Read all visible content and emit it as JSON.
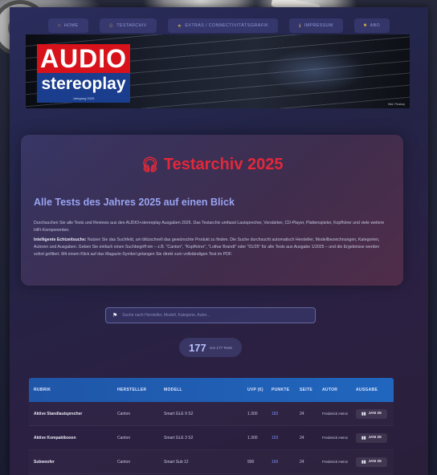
{
  "nav": [
    {
      "icon": "home-icon",
      "glyph": "⌂",
      "label": "HOME"
    },
    {
      "icon": "headphones-icon",
      "glyph": "☉",
      "label": "TESTARCHIV"
    },
    {
      "icon": "star-icon",
      "glyph": "★",
      "label": "EXTRAS / CONNECTIVITÄTSGRAFIK"
    },
    {
      "icon": "info-icon",
      "glyph": "ℹ",
      "label": "IMPRESSUM"
    },
    {
      "icon": "book-icon",
      "glyph": "■",
      "label": "ABO"
    }
  ],
  "banner": {
    "logo_audio": "AUDIO",
    "logo_stereoplay": "stereoplay",
    "logo_year": "Jahrgang 2025",
    "credit": "Bild: Pixabay"
  },
  "hero": {
    "title": "Testarchiv 2025",
    "title_icon": "headphones-icon",
    "subtitle": "Alle Tests des Jahres 2025 auf einen Blick",
    "paragraph1": "Durchsuchen Sie alle Tests und Reviews aus den AUDIO+stereoplay Ausgaben 2025. Das Testarchiv umfasst Lautsprecher, Verstärker, CD-Player, Plattenspieler, Kopfhörer und viele weitere HiFi-Komponenten.",
    "paragraph2_bold": "Intelligente Echtzeitsuche:",
    "paragraph2": " Nutzen Sie das Suchfeld, um blitzschnell das gewünschte Produkt zu finden. Die Suche durchsucht automatisch Hersteller, Modellbezeichnungen, Kategorien, Autoren und Ausgaben. Geben Sie einfach einen Suchbegriff ein – z.B. \"Canton\", \"Kopfhörer\", \"Lothar Brandt\" oder \"01/25\" für alle Tests aus Ausgabe 1/2025 – und die Ergebnisse werden sofort gefiltert. Mit einem Klick auf das Magazin-Symbol gelangen Sie direkt zum vollständigen Test im PDF."
  },
  "search": {
    "placeholder": "Suche nach Hersteller, Modell, Kategorie, Autor..."
  },
  "counter": {
    "count": "177",
    "text": "von 177 Tests"
  },
  "table": {
    "headers": [
      "RUBRIK",
      "HERSTELLER",
      "MODELL",
      "UVP (€)",
      "PUNKTE",
      "SEITE",
      "AUTOR",
      "AUSGABE"
    ],
    "rows": [
      {
        "rubrik": "Aktive Standlautsprecher",
        "hersteller": "Canton",
        "modell": "Smart GLE 9 S2",
        "uvp": "1.300",
        "punkte": "183",
        "seite": "24",
        "autor": "Frederick Heinz",
        "ausgabe": "JAN 25"
      },
      {
        "rubrik": "Aktive Kompaktboxen",
        "hersteller": "Canton",
        "modell": "Smart GLE 3 S2",
        "uvp": "1.300",
        "punkte": "163",
        "seite": "24",
        "autor": "Frederick Heinz",
        "ausgabe": "JAN 25"
      },
      {
        "rubrik": "Subwoofer",
        "hersteller": "Canton",
        "modell": "Smart Sub 12",
        "uvp": "900",
        "punkte": "160",
        "seite": "24",
        "autor": "Frederick Heinz",
        "ausgabe": "JAN 25"
      }
    ]
  },
  "colors": {
    "accent_red": "#e3283a",
    "subtitle_blue": "#98a3f0",
    "table_header_blue": "#1f56a8",
    "points_blue": "#7f8cf5"
  }
}
